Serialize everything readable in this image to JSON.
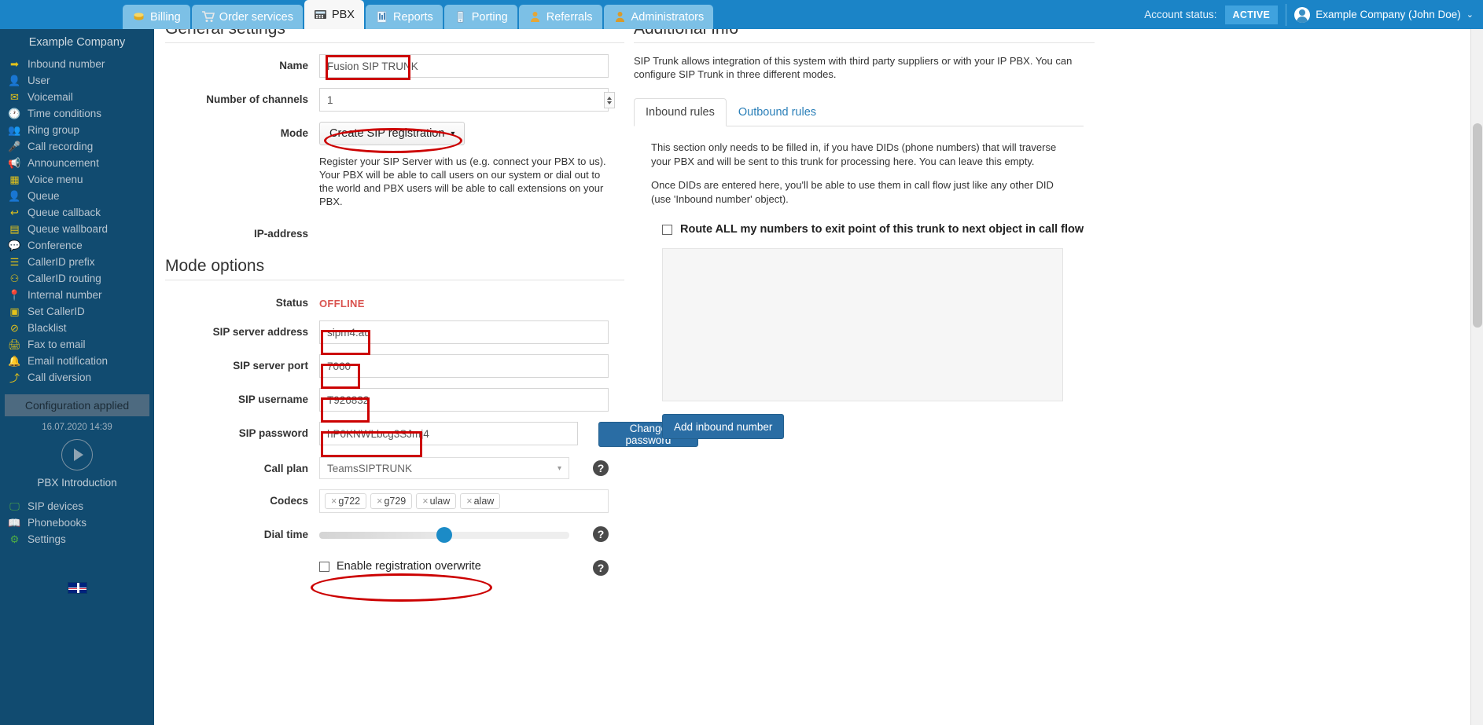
{
  "topnav": {
    "tabs": [
      {
        "label": "Billing",
        "icon": "coins-icon",
        "active": false
      },
      {
        "label": "Order services",
        "icon": "cart-icon",
        "active": false
      },
      {
        "label": "PBX",
        "icon": "pbx-icon",
        "active": true
      },
      {
        "label": "Reports",
        "icon": "report-icon",
        "active": false
      },
      {
        "label": "Porting",
        "icon": "phone-icon",
        "active": false
      },
      {
        "label": "Referrals",
        "icon": "person-icon",
        "active": false
      },
      {
        "label": "Administrators",
        "icon": "admin-icon",
        "active": false
      }
    ],
    "account_status_label": "Account status:",
    "account_status_value": "ACTIVE",
    "user_name": "Example Company (John Doe)",
    "caret": "⌄"
  },
  "sidebar": {
    "company": "Example Company",
    "items": [
      {
        "label": "Inbound number",
        "icon": "arrow-right-icon"
      },
      {
        "label": "User",
        "icon": "user-icon"
      },
      {
        "label": "Voicemail",
        "icon": "envelope-icon"
      },
      {
        "label": "Time conditions",
        "icon": "clock-icon"
      },
      {
        "label": "Ring group",
        "icon": "group-icon"
      },
      {
        "label": "Call recording",
        "icon": "microphone-icon"
      },
      {
        "label": "Announcement",
        "icon": "megaphone-icon"
      },
      {
        "label": "Voice menu",
        "icon": "grid-icon"
      },
      {
        "label": "Queue",
        "icon": "user-plus-icon"
      },
      {
        "label": "Queue callback",
        "icon": "arrow-back-icon"
      },
      {
        "label": "Queue wallboard",
        "icon": "table-icon"
      },
      {
        "label": "Conference",
        "icon": "chat-icon"
      },
      {
        "label": "CallerID prefix",
        "icon": "list-icon"
      },
      {
        "label": "CallerID routing",
        "icon": "sitemap-icon"
      },
      {
        "label": "Internal number",
        "icon": "pin-icon"
      },
      {
        "label": "Set CallerID",
        "icon": "id-card-icon"
      },
      {
        "label": "Blacklist",
        "icon": "ban-icon"
      },
      {
        "label": "Fax to email",
        "icon": "printer-icon"
      },
      {
        "label": "Email notification",
        "icon": "bell-icon"
      },
      {
        "label": "Call diversion",
        "icon": "upload-icon"
      }
    ],
    "config_applied": "Configuration applied",
    "timestamp": "16.07.2020 14:39",
    "intro_label": "PBX Introduction",
    "bottom_items": [
      {
        "label": "SIP devices",
        "icon": "monitor-icon"
      },
      {
        "label": "Phonebooks",
        "icon": "book-icon"
      },
      {
        "label": "Settings",
        "icon": "gear-icon"
      }
    ],
    "flag": "uk-flag-icon"
  },
  "general_settings": {
    "heading": "General settings",
    "name_label": "Name",
    "name_value": "Fusion SIP TRUNK",
    "channels_label": "Number of channels",
    "channels_value": "1",
    "mode_label": "Mode",
    "mode_value": "Create SIP registration",
    "mode_caret": "▾",
    "mode_help": "Register your SIP Server with us (e.g. connect your PBX to us). Your PBX will be able to call users on our system or dial out to the world and PBX users will be able to call extensions on your PBX.",
    "ip_label": "IP-address"
  },
  "mode_options": {
    "heading": "Mode options",
    "status_label": "Status",
    "status_value": "OFFLINE",
    "status_color": "#d9534f",
    "server_address_label": "SIP server address",
    "server_address_value": "sipm4.au",
    "server_port_label": "SIP server port",
    "server_port_value": "7060",
    "username_label": "SIP username",
    "username_value": "T926832",
    "password_label": "SIP password",
    "password_value": "hP0KNWLbcg3SJmj4",
    "change_password_label": "Change password",
    "call_plan_label": "Call plan",
    "call_plan_value": "TeamsSIPTRUNK",
    "codecs_label": "Codecs",
    "codecs": [
      "g722",
      "g729",
      "ulaw",
      "alaw"
    ],
    "codec_remove": "×",
    "dial_time_label": "Dial time",
    "dial_time_percent": 47,
    "overwrite_label": "Enable registration overwrite",
    "overwrite_checked": false,
    "help_icon": "?"
  },
  "additional_info": {
    "heading": "Additional Info",
    "intro": "SIP Trunk allows integration of this system with third party suppliers or with your IP PBX. You can configure SIP Trunk in three different modes.",
    "tabs": [
      {
        "label": "Inbound rules",
        "active": true
      },
      {
        "label": "Outbound rules",
        "active": false
      }
    ],
    "para1": "This section only needs to be filled in, if you have DIDs (phone numbers) that will traverse your PBX and will be sent to this trunk for processing here. You can leave this empty.",
    "para2": "Once DIDs are entered here, you'll be able to use them in call flow just like any other DID (use 'Inbound number' object).",
    "route_all_label": "Route ALL my numbers to exit point of this trunk to next object in call flow",
    "route_all_checked": false,
    "add_inbound_label": "Add inbound number"
  },
  "colors": {
    "nav_blue": "#1b84c7",
    "sidebar_blue": "#114b70",
    "annotation_red": "#cc0000",
    "accent_blue": "#2a6da4",
    "status_red": "#d9534f"
  }
}
